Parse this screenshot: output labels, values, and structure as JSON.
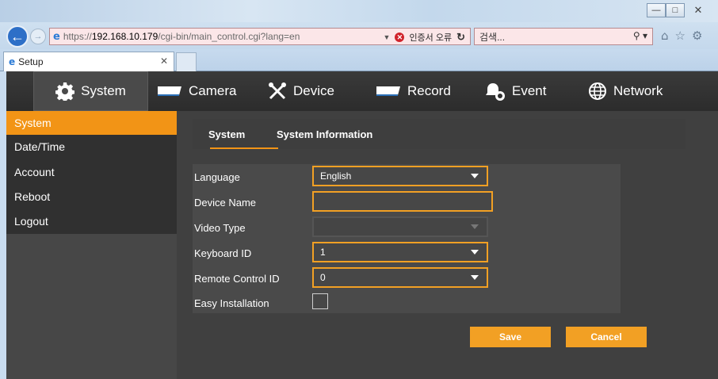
{
  "browser": {
    "url_prefix": "https://",
    "url_host": "192.168.10.179",
    "url_path": "/cgi-bin/main_control.cgi?lang=en",
    "cert_error": "인증서 오류",
    "search_placeholder": "검색...",
    "tab_title": "Setup",
    "window_buttons": [
      "minimize-icon",
      "maximize-icon",
      "close-icon"
    ]
  },
  "topnav": {
    "items": [
      {
        "label": "System",
        "icon": "gear-icon",
        "active": true
      },
      {
        "label": "Camera",
        "icon": "camera-icon"
      },
      {
        "label": "Device",
        "icon": "tools-icon"
      },
      {
        "label": "Record",
        "icon": "recorder-icon"
      },
      {
        "label": "Event",
        "icon": "bell-icon"
      },
      {
        "label": "Network",
        "icon": "globe-icon"
      }
    ]
  },
  "sidebar": {
    "items": [
      {
        "label": "System",
        "active": true
      },
      {
        "label": "Date/Time"
      },
      {
        "label": "Account"
      },
      {
        "label": "Reboot"
      },
      {
        "label": "Logout"
      }
    ]
  },
  "subtabs": [
    {
      "label": "System",
      "active": true
    },
    {
      "label": "System Information"
    }
  ],
  "form": {
    "language": {
      "label": "Language",
      "value": "English"
    },
    "device_name": {
      "label": "Device Name",
      "value": ""
    },
    "video_type": {
      "label": "Video Type",
      "value": ""
    },
    "keyboard_id": {
      "label": "Keyboard ID",
      "value": "1"
    },
    "remote_control_id": {
      "label": "Remote Control ID",
      "value": "0"
    },
    "easy_installation": {
      "label": "Easy Installation",
      "checked": false
    }
  },
  "buttons": {
    "save": "Save",
    "cancel": "Cancel"
  },
  "colors": {
    "accent": "#f29416",
    "nav_bg": "#2c2c2c",
    "content_bg": "#404040"
  }
}
